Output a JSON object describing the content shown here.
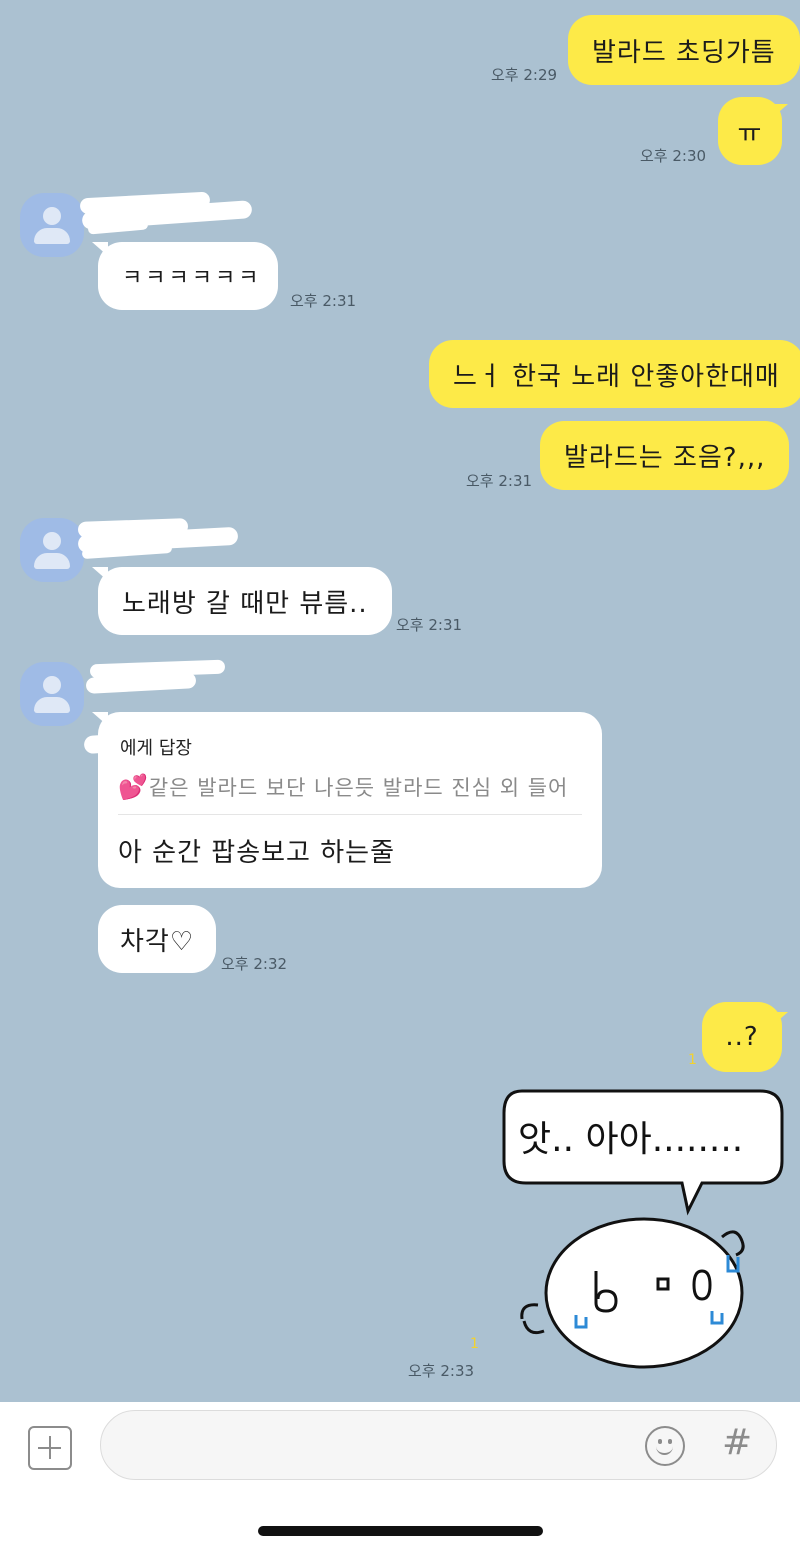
{
  "messages": {
    "m1": {
      "text": "발라드 초딩가틈",
      "time": "오후 2:29"
    },
    "m2": {
      "text": "ㅠ",
      "time": "오후 2:30"
    },
    "m3": {
      "text": "ㅋㅋㅋㅋㅋㅋ",
      "time": "오후 2:31"
    },
    "m4": {
      "text": "느ㅓ 한국 노래 안좋아한대매"
    },
    "m5": {
      "text": "발라드는 조음?,,,",
      "time": "오후 2:31"
    },
    "m6": {
      "text": "노래방 갈 때만 뷰름..",
      "time": "오후 2:31"
    },
    "m7": {
      "reply_to": "에게 답장",
      "quote": "같은 발라드 보단 나은듯 발라드 진심 외 들어",
      "text": "아 순간 팝송보고 하는줄"
    },
    "m8": {
      "text": "차각♡",
      "time": "오후 2:32"
    },
    "m9": {
      "text": "..?",
      "unread": "1"
    },
    "m10": {
      "sticker_text": "앗.. 아아........",
      "unread": "1",
      "time": "오후 2:33"
    }
  },
  "input": {
    "placeholder": "",
    "icons": {
      "attach": "plus-square-icon",
      "emoji": "smiley-icon",
      "hash": "#"
    }
  },
  "colors": {
    "background": "#abc1d1",
    "my_bubble": "#fdea48",
    "their_bubble": "#ffffff",
    "avatar": "#9fbbe6"
  }
}
